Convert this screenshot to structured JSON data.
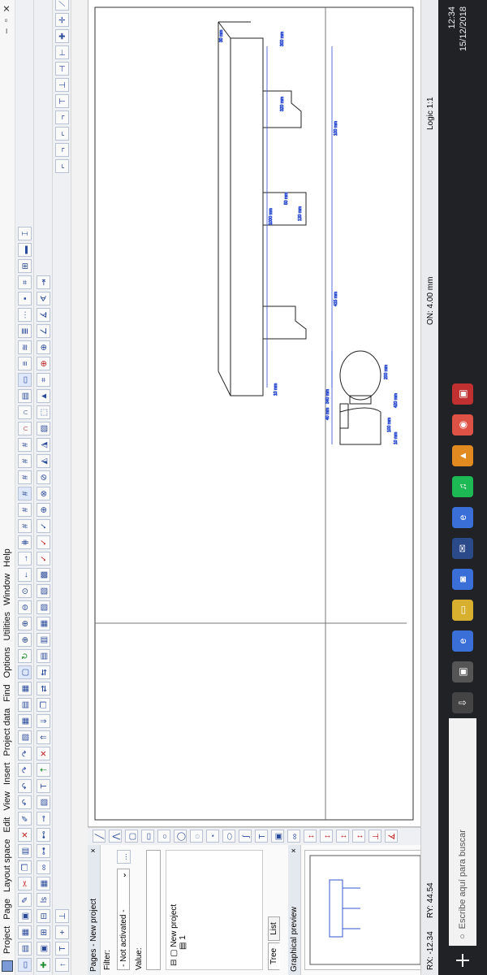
{
  "menubar": {
    "items": [
      "Project",
      "Page",
      "Layout space",
      "Edit",
      "View",
      "Insert",
      "Project data",
      "Find",
      "Options",
      "Utilities",
      "Window",
      "Help"
    ]
  },
  "left_panel": {
    "title": "Pages - New project",
    "close": "×",
    "filter_label": "Filter:",
    "filter_value": "- Not activated -",
    "filter_btn": "...",
    "value_label": "Value:",
    "tree_root": "New project",
    "tree_child": "1",
    "tabs": [
      "Tree",
      "List"
    ],
    "preview_title": "Graphical preview"
  },
  "drawing": {
    "dims": [
      "10 mm",
      "1000 mm",
      "415 mm",
      "120 mm",
      "100 mm",
      "50 mm",
      "40 mm",
      "420 mm",
      "340 mm",
      "200 mm",
      "100 mm",
      "320 mm",
      "300 mm",
      "30 mm",
      "10 mm"
    ]
  },
  "statusbar": {
    "rx": "RX: -12.34",
    "ry": "RY: 44.54",
    "on": "ON: 4.00 mm",
    "logic": "Logic 1:1"
  },
  "taskbar": {
    "search_placeholder": "Escribe aquí para buscar",
    "time": "12:34",
    "date": "15/12/2018"
  }
}
